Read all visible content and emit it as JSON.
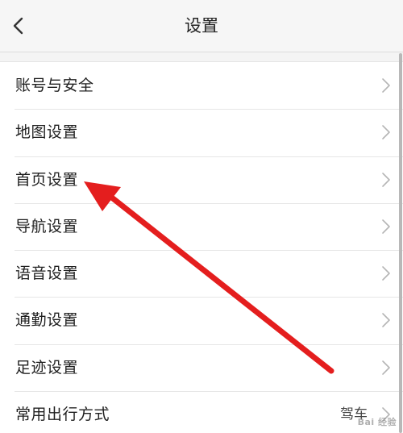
{
  "header": {
    "title": "设置",
    "back_icon": "chevron-left-icon"
  },
  "settings": {
    "items": [
      {
        "label": "账号与安全",
        "value": ""
      },
      {
        "label": "地图设置",
        "value": ""
      },
      {
        "label": "首页设置",
        "value": ""
      },
      {
        "label": "导航设置",
        "value": ""
      },
      {
        "label": "语音设置",
        "value": ""
      },
      {
        "label": "通勤设置",
        "value": ""
      },
      {
        "label": "足迹设置",
        "value": ""
      },
      {
        "label": "常用出行方式",
        "value": "驾车"
      }
    ],
    "chevron_icon": "chevron-right-icon"
  },
  "annotation": {
    "arrow_color": "#e41e1e",
    "points_to": "首页设置"
  },
  "watermark": {
    "text": "Bai 经验"
  },
  "colors": {
    "background": "#f4f4f4",
    "list_background": "#ffffff",
    "divider": "#e6e6e6",
    "text": "#1f1f1f"
  }
}
